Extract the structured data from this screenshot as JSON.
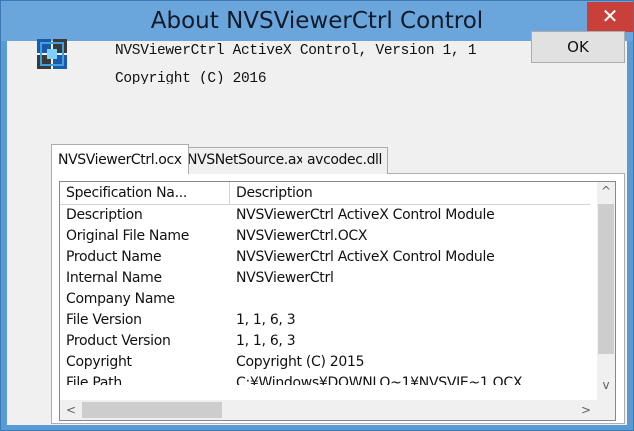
{
  "window": {
    "title": "About NVSViewerCtrl Control",
    "close_glyph": "✕"
  },
  "header": {
    "version_line": "NVSViewerCtrl ActiveX Control, Version 1, 1",
    "copyright_line": "Copyright (C) 2016",
    "ok_label": "OK",
    "icon": "application-icon"
  },
  "tabs": [
    {
      "label": "NVSViewerCtrl.ocx",
      "selected": true
    },
    {
      "label": "NVSNetSource.ax",
      "selected": false
    },
    {
      "label": "avcodec.dll",
      "selected": false
    }
  ],
  "table": {
    "columns": [
      "Specification Na...",
      "Description"
    ],
    "rows": [
      [
        "Description",
        "NVSViewerCtrl ActiveX Control Module"
      ],
      [
        "Original File Name",
        "NVSViewerCtrl.OCX"
      ],
      [
        "Product Name",
        "NVSViewerCtrl ActiveX Control Module"
      ],
      [
        "Internal Name",
        "NVSViewerCtrl"
      ],
      [
        "Company Name",
        ""
      ],
      [
        "File Version",
        "1, 1, 6, 3"
      ],
      [
        "Product Version",
        "1, 1, 6, 3"
      ],
      [
        "Copyright",
        "Copyright (C) 2015"
      ],
      [
        "File Path",
        "C:¥Windows¥DOWNLO~1¥NVSVIE~1.OCX"
      ]
    ]
  },
  "scrollbars": {
    "up_glyph": "^",
    "down_glyph": "v",
    "left_glyph": "<",
    "right_glyph": ">"
  },
  "colors": {
    "title_bar": "#6aa6dc",
    "close_button": "#c9403a"
  }
}
